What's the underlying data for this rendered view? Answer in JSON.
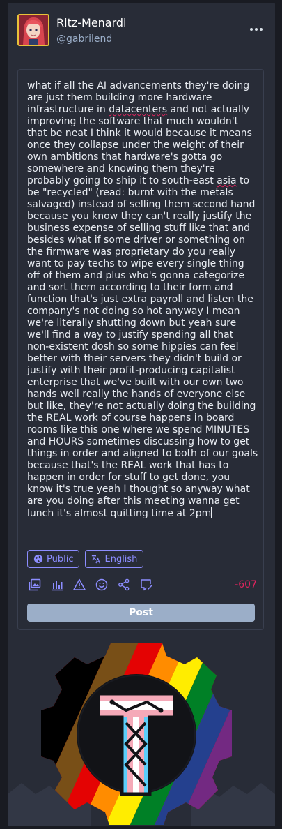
{
  "account": {
    "display_name": "Ritz-Menardi",
    "username": "@gabrilend"
  },
  "compose": {
    "text_parts": [
      "what if all the AI advancements they're doing are just them building more hardware infrastructure in ",
      "datacenters",
      " and not actually improving the software that much wouldn't that be neat I think it would because it means once they collapse under the weight of their own ambitions that hardware's gotta go somewhere and knowing them they're probably going to ship it to south-east ",
      "asia",
      " to be \"recycled\" (read: burnt with the metals salvaged) instead of selling them second hand because you know they can't really justify the business expense of selling stuff like that and besides what if some driver or something on the firmware was proprietary do you really want to pay techs to wipe every single thing off of them and plus who's gonna categorize and sort them according to their form and function that's just extra payroll and listen the company's not doing so hot anyway I mean we're literally shutting down but yeah sure we'll find a way to justify spending all that non-existent dosh so some hippies can feel better with their servers they didn't build or justify with their profit-producing capitalist enterprise that we've built with our own two hands well really the hands of everyone else but like, they're not actually doing the building the REAL work of course happens in board rooms like this one where we spend MINUTES and HOURS sometimes discussing how to get things in order and aligned to both of our goals because that's the REAL work that has to happen in order for stuff to get done, you know it's true yeah I thought so anyway what are you doing after this meeting wanna get lunch it's almost quitting time at 2pm"
    ],
    "visibility_label": "Public",
    "language_label": "English",
    "char_counter": "-607",
    "post_label": "Post"
  },
  "icons": {
    "visibility": "globe-icon",
    "language": "translate-icon",
    "tools": [
      "image-icon",
      "poll-icon",
      "warning-icon",
      "emoji-icon",
      "share-icon",
      "draft-icon"
    ],
    "menu": "ellipsis-icon"
  },
  "colors": {
    "accent": "#8c8dff",
    "counter_over_limit": "#e0245e",
    "post_button_disabled": "#9baec8"
  }
}
